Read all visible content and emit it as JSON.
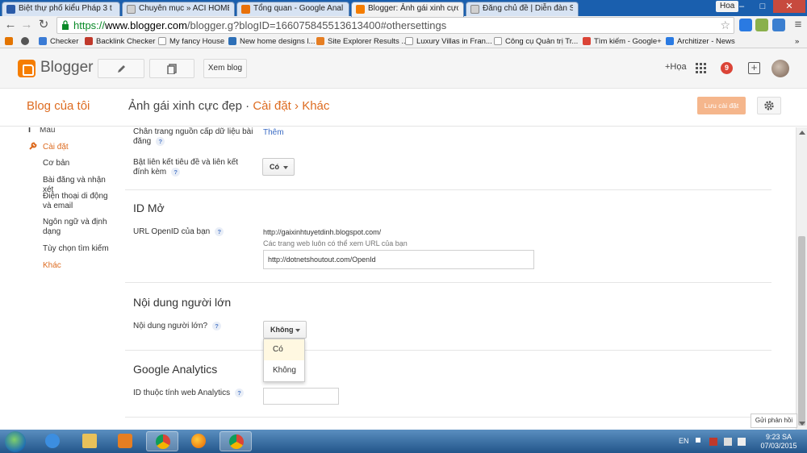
{
  "browser": {
    "tabs": [
      {
        "label": "Biệt thự phố kiểu Pháp 3 t",
        "color": "#2b5ba8"
      },
      {
        "label": "Chuyên mục » ACI HOME",
        "color": "#7a7a7a"
      },
      {
        "label": "Tổng quan - Google Anal",
        "color": "#e8710a"
      },
      {
        "label": "Blogger: Ảnh gái xinh cực",
        "color": "#f57d00"
      },
      {
        "label": "Đăng chủ đề | Diễn đàn SE",
        "color": "#6b6b6b"
      }
    ],
    "user": "Hoa",
    "url": {
      "scheme": "https://",
      "host": "www.blogger.com",
      "path": "/blogger.g?blogID=1660758455136134​00#othersettings"
    },
    "bookmarks": [
      {
        "label": "",
        "color": "#e37400"
      },
      {
        "label": "",
        "color": "#555555"
      },
      {
        "label": "Checker",
        "color": "#3a7bd5"
      },
      {
        "label": "Backlink Checker",
        "color": "#c0392b"
      },
      {
        "label": "My fancy House",
        "color": "#777777"
      },
      {
        "label": "New home designs l...",
        "color": "#2d6fb7"
      },
      {
        "label": "Site Explorer Results ...",
        "color": "#e67e22"
      },
      {
        "label": "Luxury Villas in Fran...",
        "color": "#777777"
      },
      {
        "label": "Công cụ Quản trị Tr...",
        "color": "#777777"
      },
      {
        "label": "Tìm kiếm - Google+",
        "color": "#db4437"
      },
      {
        "label": "Architizer - News",
        "color": "#2a7ae2"
      }
    ]
  },
  "header": {
    "brand": "Blogger",
    "view_blog_label": "Xem blog",
    "plus_user": "+Họa",
    "notification_count": "9"
  },
  "titlebar": {
    "my_blogs": "Blog của tôi",
    "blog_name": "Ảnh gái xinh cực đẹp",
    "sep1": "·",
    "settings": "Cài đặt",
    "sep2": "›",
    "other": "Khác",
    "save_label": "Lưu cài đặt"
  },
  "sidebar": {
    "design": "Mẫu",
    "settings": "Cài đặt",
    "items": [
      "Cơ bản",
      "Bài đăng và nhận xét",
      "Điện thoại di động và email",
      "Ngôn ngữ và định dạng",
      "Tùy chọn tìm kiếm",
      "Khác"
    ]
  },
  "main": {
    "feed_footer_label": "Chân trang nguồn cấp dữ liệu bài đăng",
    "feed_footer_link": "Thêm",
    "title_links_label": "Bật liên kết tiêu đề và liên kết đính kèm",
    "title_links_value": "Có",
    "openid_heading": "ID Mở",
    "openid_label": "URL OpenID của bạn",
    "openid_url": "http://gaixinhtuyetdinh.blogspot.com/",
    "openid_sub": "Các trang web luôn có thể xem URL của bạn",
    "openid_input": "http://dotnetshoutout.com/OpenId",
    "adult_heading": "Nội dung người lớn",
    "adult_label": "Nội dung người lớn?",
    "adult_value": "Không",
    "adult_options": [
      "Có",
      "Không"
    ],
    "ga_heading": "Google Analytics",
    "ga_label": "ID thuộc tính web Analytics",
    "ga_value": "",
    "help": "?"
  },
  "feedback_label": "Gửi phản hồi",
  "taskbar": {
    "lang": "EN",
    "time": "9:23 SA",
    "date": "07/03/2015"
  }
}
